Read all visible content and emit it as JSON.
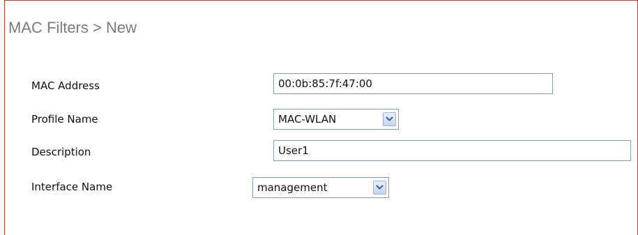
{
  "page": {
    "title": "MAC Filters > New"
  },
  "form": {
    "mac_address": {
      "label": "MAC Address",
      "value": "00:0b:85:7f:47:00"
    },
    "profile_name": {
      "label": "Profile Name",
      "selected": "MAC-WLAN"
    },
    "description": {
      "label": "Description",
      "value": "User1"
    },
    "interface_name": {
      "label": "Interface Name",
      "selected": "management"
    }
  },
  "icons": {
    "dropdown": "chevron-down-icon"
  },
  "colors": {
    "frame_border": "#d9312a",
    "title_text": "#7a7a7a",
    "input_border": "#7f9db9",
    "dropdown_button": "#c3d3fd",
    "chevron": "#4d6185"
  }
}
